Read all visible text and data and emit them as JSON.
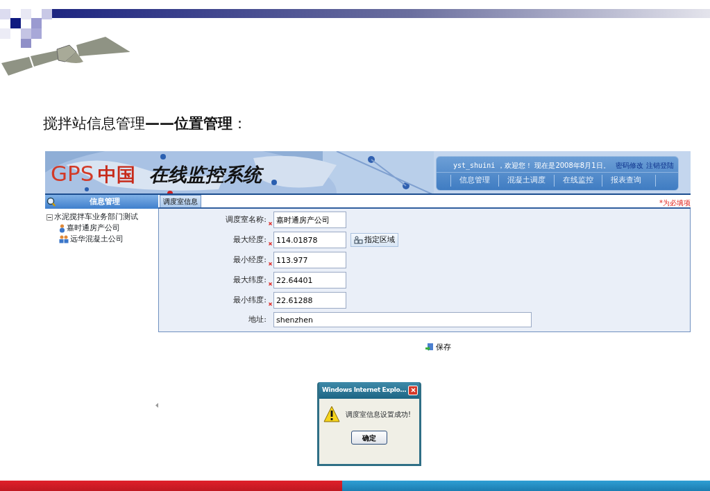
{
  "slide": {
    "title": "搅拌站信息管理**——位置管理**："
  },
  "app": {
    "logo_latin": "GPS",
    "logo_cn": "中国",
    "system_name": "在线监控系统",
    "user_bar": {
      "user": "yst_shuini",
      "greeting": "，欢迎您！ 现在是2008年8月1日。",
      "links": [
        "密码修改",
        "注销登陆"
      ]
    },
    "nav": [
      "信息管理",
      "混凝土调度",
      "在线监控",
      "报表查询"
    ],
    "sidebar": {
      "title": "信息管理",
      "tree": [
        {
          "label": "水泥搅拌车业务部门测试",
          "expanded": true,
          "children": [
            {
              "label": "嘉时通房产公司",
              "kind": "single"
            },
            {
              "label": "远华混凝土公司",
              "kind": "group"
            }
          ]
        }
      ]
    },
    "tabs": [
      {
        "label": "调度室信息",
        "selected": true
      }
    ],
    "required_note": "*为必填项",
    "form": [
      {
        "label": "调度室名称:",
        "required": true,
        "value": "嘉时通房产公司"
      },
      {
        "label": "最大经度:",
        "required": true,
        "value": "114.01878",
        "button": "指定区域"
      },
      {
        "label": "最小经度:",
        "required": true,
        "value": "113.977"
      },
      {
        "label": "最大纬度:",
        "required": true,
        "value": "22.64401"
      },
      {
        "label": "最小纬度:",
        "required": true,
        "value": "22.61288"
      },
      {
        "label": "地址:",
        "required": false,
        "value": "shenzhen",
        "wide": true
      }
    ],
    "save_button": "保存",
    "dialog": {
      "title": "Windows Internet Explo...",
      "message": "调度室信息设置成功!",
      "ok": "确定"
    }
  }
}
